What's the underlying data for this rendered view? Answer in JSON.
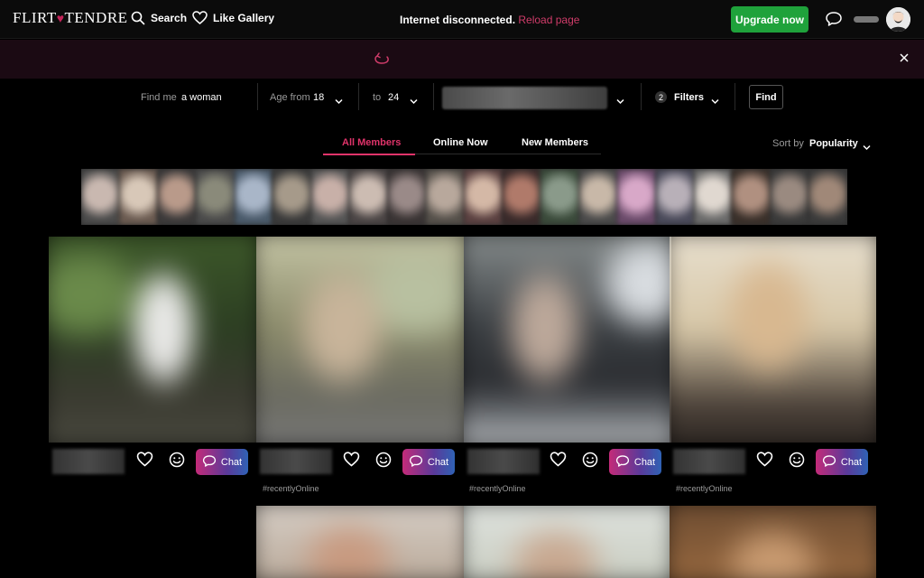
{
  "header": {
    "logo_left": "FLIRT",
    "logo_heart": "♥",
    "logo_right": "TENDRE",
    "search_label": "Search",
    "like_gallery_label": "Like Gallery",
    "upgrade_label": "Upgrade now",
    "icons": [
      "search-icon",
      "heart-icon",
      "chat-icon",
      "avatar"
    ]
  },
  "banner": {
    "message": "Internet disconnected.",
    "reload_link": "Reload page",
    "icons": [
      "reload-icon",
      "close-icon"
    ]
  },
  "filters": {
    "find_me_label": "Find me",
    "find_me_value": "a woman",
    "age_from_label": "Age from",
    "age_from_value": "18",
    "age_to_label": "to",
    "age_to_value": "24",
    "filters_count": "2",
    "filters_label": "Filters",
    "find_button": "Find"
  },
  "tabs": [
    {
      "label": "All Members",
      "active": true
    },
    {
      "label": "Online Now",
      "active": false
    },
    {
      "label": "New Members",
      "active": false
    }
  ],
  "sort": {
    "label": "Sort by",
    "value": "Popularity"
  },
  "cards": [
    {
      "chat_label": "Chat",
      "tag": ""
    },
    {
      "chat_label": "Chat",
      "tag": "#recentlyOnline"
    },
    {
      "chat_label": "Chat",
      "tag": "#recentlyOnline"
    },
    {
      "chat_label": "Chat",
      "tag": "#recentlyOnline"
    }
  ],
  "colors": {
    "accent": "#e0336a",
    "upgrade": "#1fa23b",
    "banner_bg": "#1b0a13"
  }
}
